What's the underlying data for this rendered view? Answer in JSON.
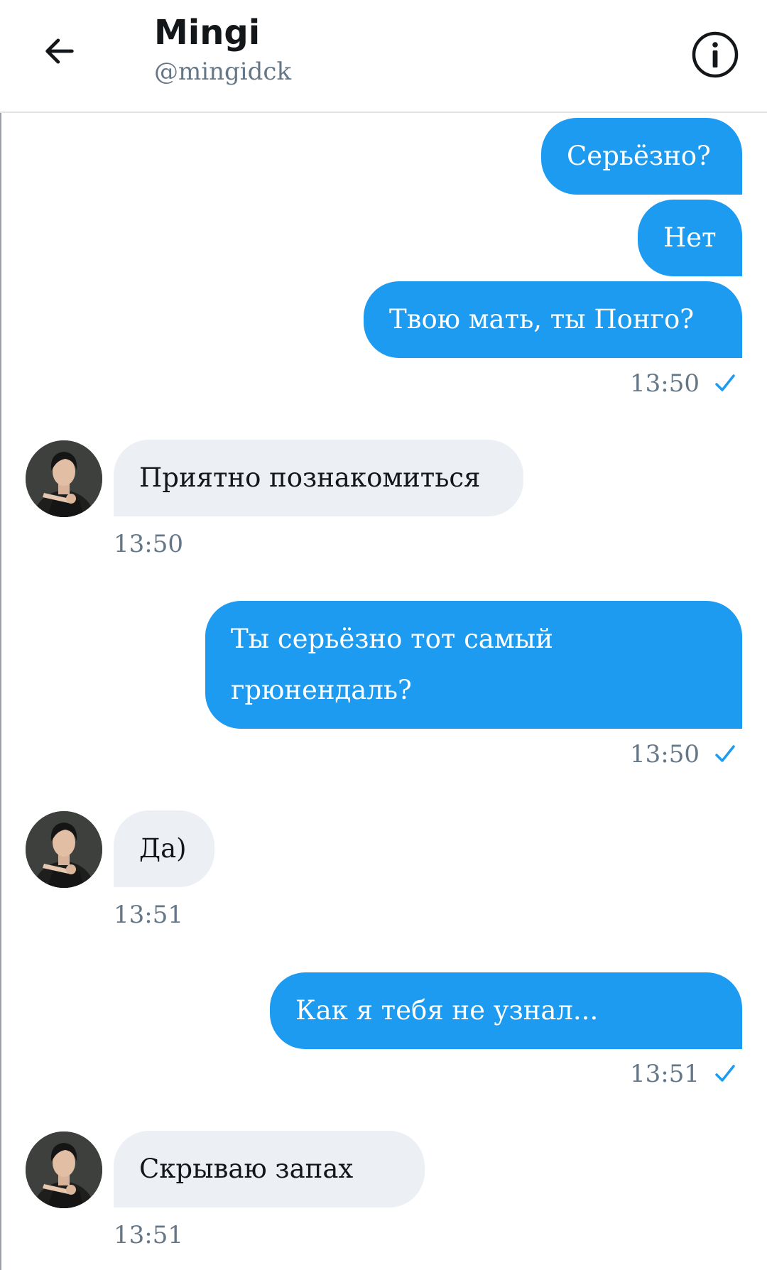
{
  "header": {
    "title": "Mingi",
    "handle": "@mingidck",
    "back_icon": "arrow-left-icon",
    "info_icon": "info-circle-icon"
  },
  "colors": {
    "sent_bubble": "#1d9bf0",
    "received_bubble": "#eceff3",
    "timestamp": "#657786",
    "check": "#1d9bf0"
  },
  "messages": [
    {
      "direction": "sent",
      "text": "Серьёзно?"
    },
    {
      "direction": "sent",
      "text": "Нет"
    },
    {
      "direction": "sent",
      "text": "Твою мать, ты Понго?",
      "time": "13:50",
      "read": true
    },
    {
      "direction": "received",
      "text": "Приятно познакомиться",
      "time": "13:50"
    },
    {
      "direction": "sent",
      "text": "Ты серьёзно тот самый",
      "text_line2": "грюнендаль?",
      "time": "13:50",
      "read": true
    },
    {
      "direction": "received",
      "text": "Да)",
      "time": "13:51"
    },
    {
      "direction": "sent",
      "text": "Как я тебя не узнал...",
      "time": "13:51",
      "read": true
    },
    {
      "direction": "received",
      "text": "Скрываю запах",
      "time": "13:51"
    }
  ]
}
